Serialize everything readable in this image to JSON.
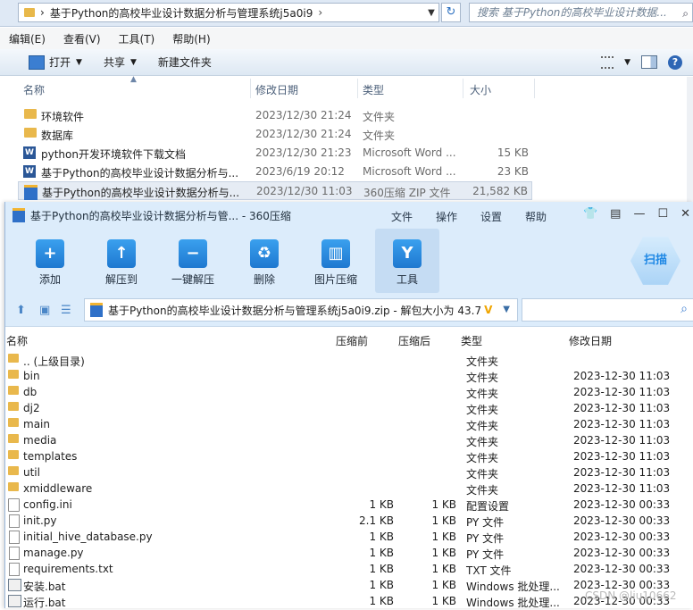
{
  "explorer": {
    "address_crumb": "基于Python的高校毕业设计数据分析与管理系统j5a0i9",
    "address_sep": "›",
    "search_placeholder": "搜索 基于Python的高校毕业设计数据...",
    "menu": [
      "编辑(E)",
      "查看(V)",
      "工具(T)",
      "帮助(H)"
    ],
    "toolbar": {
      "open": "打开",
      "share": "共享",
      "new_folder": "新建文件夹"
    },
    "columns": {
      "name": "名称",
      "date": "修改日期",
      "type": "类型",
      "size": "大小"
    },
    "files": [
      {
        "name": "环境软件",
        "date": "2023/12/30 21:24",
        "type": "文件夹",
        "size": "",
        "icon": "folder-icon"
      },
      {
        "name": "数据库",
        "date": "2023/12/30 21:24",
        "type": "文件夹",
        "size": "",
        "icon": "folder-icon"
      },
      {
        "name": "python开发环境软件下载文档",
        "date": "2023/12/30 21:23",
        "type": "Microsoft Word ...",
        "size": "15 KB",
        "icon": "word-icon"
      },
      {
        "name": "基于Python的高校毕业设计数据分析与...",
        "date": "2023/6/19 20:12",
        "type": "Microsoft Word ...",
        "size": "23 KB",
        "icon": "word-icon"
      },
      {
        "name": "基于Python的高校毕业设计数据分析与...",
        "date": "2023/12/30 11:03",
        "type": "360压缩 ZIP 文件",
        "size": "21,582 KB",
        "icon": "zip-icon",
        "selected": true
      }
    ]
  },
  "zip": {
    "title": "基于Python的高校毕业设计数据分析与管... - 360压缩",
    "menu": [
      "文件",
      "操作",
      "设置",
      "帮助"
    ],
    "tools": [
      {
        "label": "添加",
        "icon": "add-icon",
        "glyph": "+"
      },
      {
        "label": "解压到",
        "icon": "extract-to-icon",
        "glyph": "↑"
      },
      {
        "label": "一键解压",
        "icon": "one-click-extract-icon",
        "glyph": "−"
      },
      {
        "label": "删除",
        "icon": "recycle-icon",
        "glyph": "♻"
      },
      {
        "label": "图片压缩",
        "icon": "image-compress-icon",
        "glyph": "▥"
      },
      {
        "label": "工具",
        "icon": "tools-icon",
        "glyph": "Y"
      }
    ],
    "scan": "扫描",
    "path": "基于Python的高校毕业设计数据分析与管理系统j5a0i9.zip - 解包大小为 43.7",
    "columns": {
      "name": "名称",
      "before": "压缩前",
      "after": "压缩后",
      "type": "类型",
      "date": "修改日期"
    },
    "files": [
      {
        "name": ".. (上级目录)",
        "before": "",
        "after": "",
        "type": "文件夹",
        "date": "",
        "icon": "folder-icon"
      },
      {
        "name": "bin",
        "before": "",
        "after": "",
        "type": "文件夹",
        "date": "2023-12-30 11:03",
        "icon": "folder-icon"
      },
      {
        "name": "db",
        "before": "",
        "after": "",
        "type": "文件夹",
        "date": "2023-12-30 11:03",
        "icon": "folder-icon"
      },
      {
        "name": "dj2",
        "before": "",
        "after": "",
        "type": "文件夹",
        "date": "2023-12-30 11:03",
        "icon": "folder-icon"
      },
      {
        "name": "main",
        "before": "",
        "after": "",
        "type": "文件夹",
        "date": "2023-12-30 11:03",
        "icon": "folder-icon"
      },
      {
        "name": "media",
        "before": "",
        "after": "",
        "type": "文件夹",
        "date": "2023-12-30 11:03",
        "icon": "folder-icon"
      },
      {
        "name": "templates",
        "before": "",
        "after": "",
        "type": "文件夹",
        "date": "2023-12-30 11:03",
        "icon": "folder-icon"
      },
      {
        "name": "util",
        "before": "",
        "after": "",
        "type": "文件夹",
        "date": "2023-12-30 11:03",
        "icon": "folder-icon"
      },
      {
        "name": "xmiddleware",
        "before": "",
        "after": "",
        "type": "文件夹",
        "date": "2023-12-30 11:03",
        "icon": "folder-icon"
      },
      {
        "name": "config.ini",
        "before": "1 KB",
        "after": "1 KB",
        "type": "配置设置",
        "date": "2023-12-30 00:33",
        "icon": "config-file-icon"
      },
      {
        "name": "init.py",
        "before": "2.1 KB",
        "after": "1 KB",
        "type": "PY 文件",
        "date": "2023-12-30 00:33",
        "icon": "file-icon"
      },
      {
        "name": "initial_hive_database.py",
        "before": "1 KB",
        "after": "1 KB",
        "type": "PY 文件",
        "date": "2023-12-30 00:33",
        "icon": "file-icon"
      },
      {
        "name": "manage.py",
        "before": "1 KB",
        "after": "1 KB",
        "type": "PY 文件",
        "date": "2023-12-30 00:33",
        "icon": "file-icon"
      },
      {
        "name": "requirements.txt",
        "before": "1 KB",
        "after": "1 KB",
        "type": "TXT 文件",
        "date": "2023-12-30 00:33",
        "icon": "file-icon"
      },
      {
        "name": "安装.bat",
        "before": "1 KB",
        "after": "1 KB",
        "type": "Windows 批处理...",
        "date": "2023-12-30 00:33",
        "icon": "bat-file-icon"
      },
      {
        "name": "运行.bat",
        "before": "1 KB",
        "after": "1 KB",
        "type": "Windows 批处理...",
        "date": "2023-12-30 00:33",
        "icon": "bat-file-icon"
      }
    ]
  },
  "watermark": "CSDN @liu10662"
}
